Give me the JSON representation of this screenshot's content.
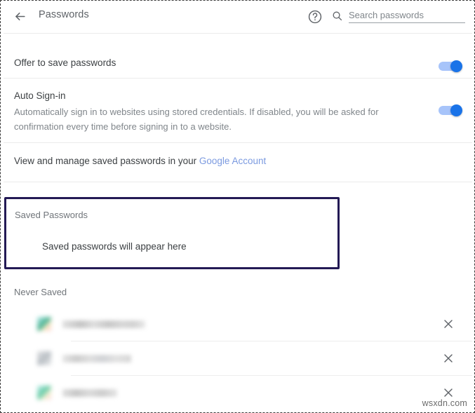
{
  "header": {
    "title": "Passwords",
    "back_icon": "arrow-left-icon",
    "help_icon": "help-circle-icon",
    "search": {
      "icon": "search-icon",
      "placeholder": "Search passwords",
      "value": ""
    }
  },
  "settings": [
    {
      "label": "Offer to save passwords",
      "description": "",
      "toggle_on": true
    },
    {
      "label": "Auto Sign-in",
      "description": "Automatically sign in to websites using stored credentials. If disabled, you will be asked for confirmation every time before signing in to a website.",
      "toggle_on": true
    }
  ],
  "account_line": {
    "text": "View and manage saved passwords in your ",
    "link_label": "Google Account"
  },
  "saved_passwords": {
    "section_title": "Saved Passwords",
    "empty_message": "Saved passwords will appear here",
    "highlight_color": "#231a55"
  },
  "never_saved": {
    "section_title": "Never Saved",
    "rows": [
      {
        "site": "",
        "favicon": "site-favicon-1",
        "remove_icon": "close-icon"
      },
      {
        "site": "",
        "favicon": "site-favicon-2",
        "remove_icon": "close-icon"
      },
      {
        "site": "",
        "favicon": "site-favicon-3",
        "remove_icon": "close-icon"
      }
    ]
  },
  "watermark": "wsxdn.com",
  "colors": {
    "accent": "#1a73e8",
    "toggle_track": "#a7c4fa",
    "link": "#7b9ae0",
    "text_primary": "#3c4043",
    "text_secondary": "#80868b",
    "highlight_border": "#231a55"
  }
}
